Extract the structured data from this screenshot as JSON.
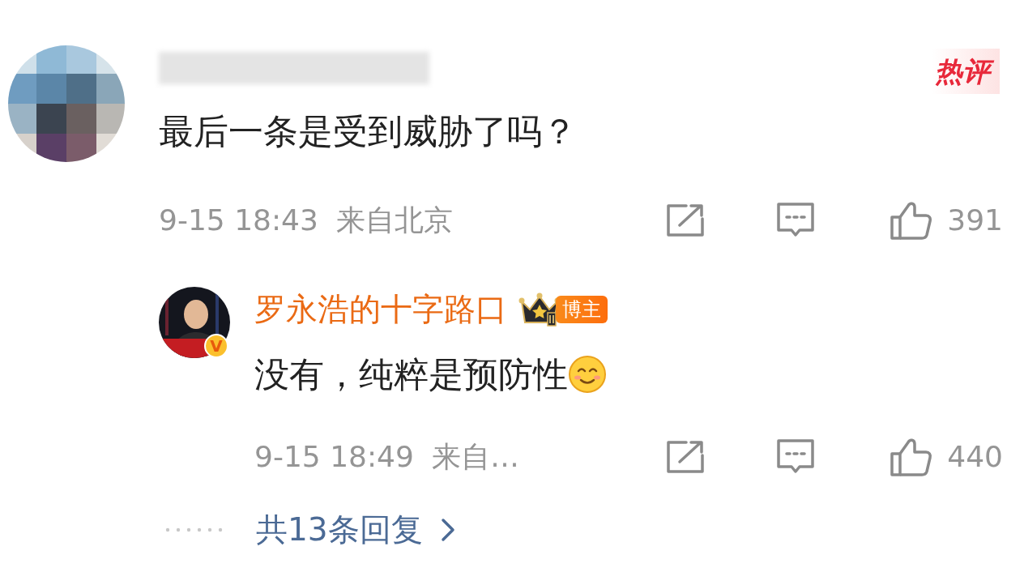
{
  "comment": {
    "hot_badge": "热评",
    "text": "最后一条是受到威胁了吗？",
    "time": "9-15 18:43",
    "location": "来自北京",
    "likes": "391"
  },
  "reply": {
    "author": "罗永浩的十字路口",
    "verified_mark": "V",
    "role_badge": "博主",
    "text": "没有，纯粹是预防性",
    "time": "9-15 18:49",
    "location": "来自…",
    "likes": "440"
  },
  "more_replies": {
    "label": "共13条回复"
  }
}
